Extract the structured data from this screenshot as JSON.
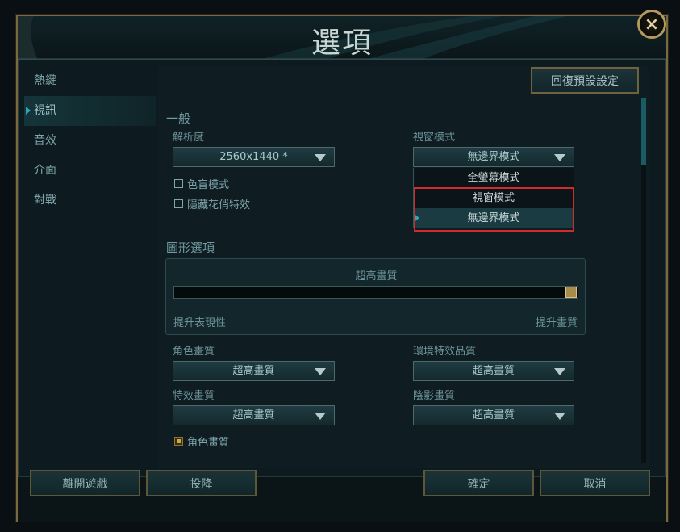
{
  "window": {
    "title": "選項"
  },
  "close_icon": "×",
  "sidebar": {
    "items": [
      {
        "label": "熱鍵"
      },
      {
        "label": "視訊",
        "active": true
      },
      {
        "label": "音效"
      },
      {
        "label": "介面"
      },
      {
        "label": "對戰"
      }
    ]
  },
  "toolbar": {
    "reset_label": "回復預設設定"
  },
  "general": {
    "section_title": "一般",
    "resolution_label": "解析度",
    "resolution_value": "2560x1440 *",
    "colorblind_label": "色盲模式",
    "hide_cosmetics_label": "隱藏花俏特效",
    "window_mode_label": "視窗模式",
    "window_mode_value": "無邊界模式",
    "window_mode_options": [
      "全螢幕模式",
      "視窗模式",
      "無邊界模式"
    ],
    "window_mode_selected": "無邊界模式"
  },
  "graphics": {
    "section_title": "圖形選項",
    "quality_label": "超高畫質",
    "quality_level": 1.0,
    "left_hint": "提升表現性",
    "right_hint": "提升畫質",
    "character_quality_label": "角色畫質",
    "character_quality_value": "超高畫質",
    "environment_quality_label": "環境特效品質",
    "environment_quality_value": "超高畫質",
    "effects_quality_label": "特效畫質",
    "effects_quality_value": "超高畫質",
    "shadow_quality_label": "陰影畫質",
    "shadow_quality_value": "超高畫質",
    "character_inking_label": "角色畫質"
  },
  "footer": {
    "exit_game_label": "離開遊戲",
    "surrender_label": "投降",
    "confirm_label": "確定",
    "cancel_label": "取消"
  },
  "colors": {
    "accent": "#2ea5b7",
    "gold_border": "#7a6a3f",
    "highlight": "#d12b2b"
  }
}
